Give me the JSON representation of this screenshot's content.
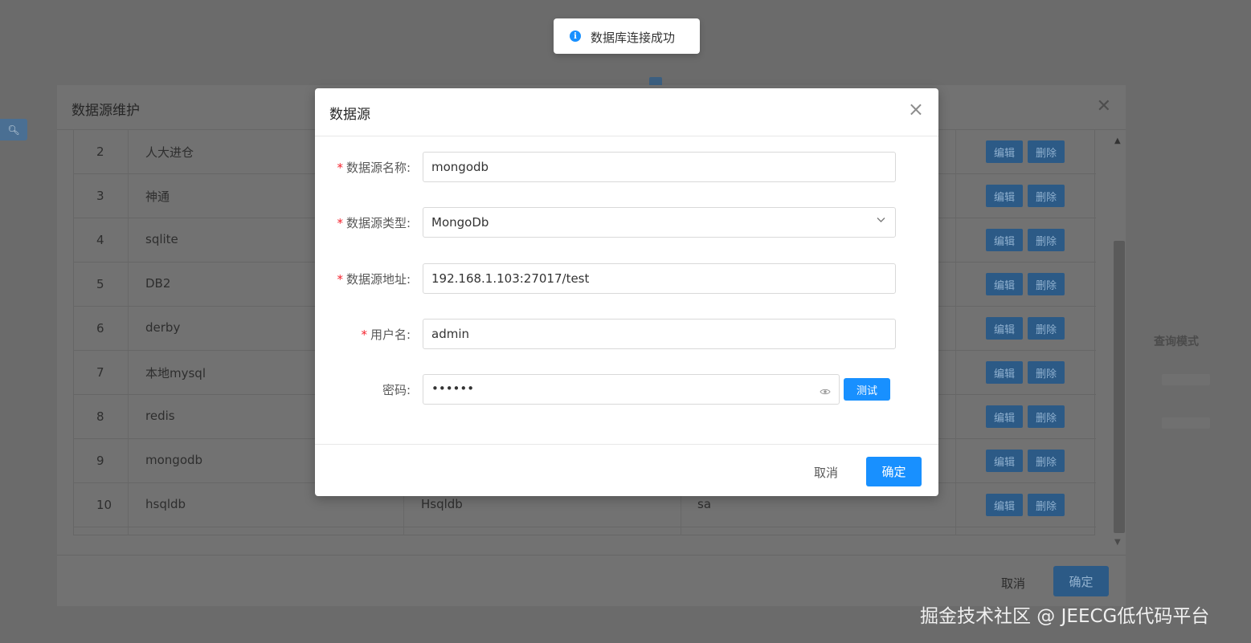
{
  "toast": {
    "icon": "info-circle-icon",
    "text": "数据库连接成功"
  },
  "outer_modal": {
    "title": "数据源维护",
    "rows": [
      {
        "index": "2",
        "name": "人大进仓",
        "type": "",
        "user": "",
        "edit": "编辑",
        "delete": "删除"
      },
      {
        "index": "3",
        "name": "神通",
        "type": "",
        "user": "",
        "edit": "编辑",
        "delete": "删除"
      },
      {
        "index": "4",
        "name": "sqlite",
        "type": "",
        "user": "",
        "edit": "编辑",
        "delete": "删除"
      },
      {
        "index": "5",
        "name": "DB2",
        "type": "",
        "user": "",
        "edit": "编辑",
        "delete": "删除"
      },
      {
        "index": "6",
        "name": "derby",
        "type": "",
        "user": "",
        "edit": "编辑",
        "delete": "删除"
      },
      {
        "index": "7",
        "name": "本地mysql",
        "type": "",
        "user": "",
        "edit": "编辑",
        "delete": "删除"
      },
      {
        "index": "8",
        "name": "redis",
        "type": "",
        "user": "",
        "edit": "编辑",
        "delete": "删除"
      },
      {
        "index": "9",
        "name": "mongodb",
        "type": "",
        "user": "",
        "edit": "编辑",
        "delete": "删除"
      },
      {
        "index": "10",
        "name": "hsqldb",
        "type": "Hsqldb",
        "user": "sa",
        "edit": "编辑",
        "delete": "删除"
      }
    ],
    "cancel": "取消",
    "ok": "确定"
  },
  "background": {
    "side_label": "查询模式"
  },
  "dialog": {
    "title": "数据源",
    "fields": {
      "name": {
        "label": "数据源名称:",
        "value": "mongodb",
        "required": true
      },
      "type": {
        "label": "数据源类型:",
        "value": "MongoDb",
        "required": true
      },
      "address": {
        "label": "数据源地址:",
        "value": "192.168.1.103:27017/test",
        "required": true
      },
      "username": {
        "label": "用户名:",
        "value": "admin",
        "required": true
      },
      "password": {
        "label": "密码:",
        "value": "••••••",
        "required": false
      }
    },
    "test_button": "测试",
    "cancel": "取消",
    "ok": "确定"
  },
  "watermark": "掘金技术社区 @ JEECG低代码平台",
  "colors": {
    "primary": "#1890ff",
    "required": "#f5222d",
    "overlay": "#6b6b6b"
  }
}
